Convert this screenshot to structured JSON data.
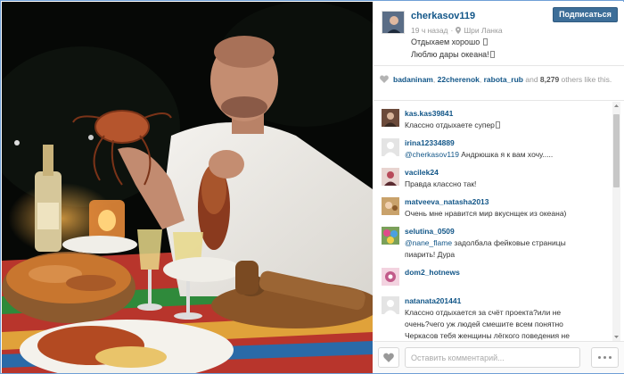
{
  "post": {
    "username": "cherkasov119",
    "follow_label": "Подписаться",
    "time_ago": "19 ч назад",
    "separator": "·",
    "location": "Шри Ланка",
    "caption_line1": "Отдыхаем хорошо ",
    "caption_line2": "Люблю дары океана!"
  },
  "likes": {
    "user1": "badaninam",
    "sep1": ", ",
    "user2": "22cherenok",
    "sep2": ", ",
    "user3": "rabota_rub",
    "and_text": " and ",
    "count": "8,279",
    "suffix": " others like this."
  },
  "comments": [
    {
      "user": "kas.kas39841",
      "text": "Классно отдыхаете супер",
      "avatar_color": "#6b4a3a"
    },
    {
      "user": "irina12334889",
      "mention": "@cherkasov119",
      "text": " Андрюшка я к вам хочу.....",
      "avatar_color": "#d9d9d9"
    },
    {
      "user": "vacilek24",
      "text": "Правда классно так!",
      "avatar_color": "#b84a5a"
    },
    {
      "user": "matveeva_natasha2013",
      "text": "Очень мне нравится мир вкуснщек из океана)",
      "avatar_color": "#c9a26b"
    },
    {
      "user": "selutina_0509",
      "mention": "@nane_flame",
      "text": " задолбала фейковые страницы",
      "text2": "пиарить! Дура",
      "avatar_color": "#7aa05a"
    },
    {
      "user": "dom2_hotnews",
      "text": "",
      "avatar_color": "#c25a8a"
    },
    {
      "user": "natanata201441",
      "text": "Классно отдыхается за счёт проекта?или не",
      "text2": "очень?чего уж людей смешите всем понятно",
      "text3": "Черкасов тебя женщины лёгкого поведения не",
      "avatar_color": "#d9d9d9"
    }
  ],
  "footer": {
    "comment_placeholder": "Оставить комментарий...",
    "heart_icon": "heart-icon",
    "more_icon": "ellipsis-icon"
  },
  "colors": {
    "link": "#125688",
    "follow_bg": "#3d6e98",
    "frame": "#6f9fd6"
  }
}
